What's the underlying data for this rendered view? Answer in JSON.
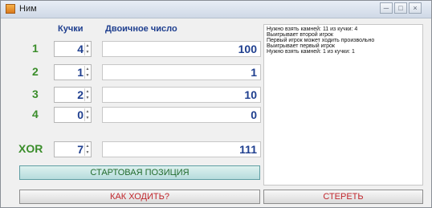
{
  "window": {
    "title": "Ним"
  },
  "headings": {
    "piles": "Кучки",
    "binary": "Двоичное число"
  },
  "rows": [
    {
      "label": "1",
      "value": "4",
      "binary": "100"
    },
    {
      "label": "2",
      "value": "1",
      "binary": "1"
    },
    {
      "label": "3",
      "value": "2",
      "binary": "10"
    },
    {
      "label": "4",
      "value": "0",
      "binary": "0"
    }
  ],
  "xor": {
    "label": "XOR",
    "value": "7",
    "binary": "111"
  },
  "buttons": {
    "start_position": "СТАРТОВАЯ ПОЗИЦИЯ",
    "how_to_move": "КАК ХОДИТЬ?",
    "clear": "СТЕРЕТЬ"
  },
  "log": [
    "Нужно взять камней: 11 из кучки: 4",
    "Выигрывает второй игрок",
    "Первый игрок может ходить произвольно",
    "Выигрывает первый игрок",
    "Нужно взять камней: 1 из кучки: 1"
  ],
  "colors": {
    "accent_blue": "#1f3f8f",
    "accent_green": "#3a8d2a",
    "accent_red": "#c1272d"
  }
}
